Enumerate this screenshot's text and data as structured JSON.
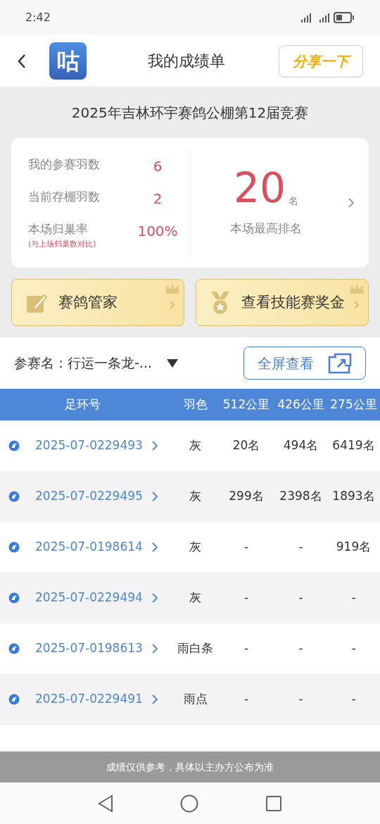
{
  "status_bar": {
    "time": "2:42"
  },
  "header": {
    "logo_text": "咕",
    "title": "我的成绩单",
    "share_button": "分享一下"
  },
  "race_title": "2025年吉林环宇赛鸽公棚第12届竞赛",
  "summary": {
    "stats": [
      {
        "label": "我的参赛羽数",
        "value": "6"
      },
      {
        "label": "当前存棚羽数",
        "value": "2"
      },
      {
        "label": "本场归巢率",
        "value": "100%",
        "note": "(与上场归巢数对比)"
      }
    ],
    "best_rank": "20",
    "rank_unit": "名",
    "rank_label": "本场最高排名"
  },
  "actions": [
    {
      "kind": "pencil",
      "label": "赛鸽管家"
    },
    {
      "kind": "medal",
      "label": "查看技能赛奖金"
    }
  ],
  "entrant": {
    "label": "参赛名：",
    "value": "行运一条龙-...",
    "fullscreen_button": "全屏查看"
  },
  "table": {
    "columns": [
      "足环号",
      "羽色",
      "512公里",
      "426公里",
      "275公里"
    ],
    "rows": [
      {
        "ring": "2025-07-0229493",
        "plumage": "灰",
        "r512": "20名",
        "r426": "494名",
        "r275": "6419名"
      },
      {
        "ring": "2025-07-0229495",
        "plumage": "灰",
        "r512": "299名",
        "r426": "2398名",
        "r275": "1893名"
      },
      {
        "ring": "2025-07-0198614",
        "plumage": "灰",
        "r512": "-",
        "r426": "-",
        "r275": "919名"
      },
      {
        "ring": "2025-07-0229494",
        "plumage": "灰",
        "r512": "-",
        "r426": "-",
        "r275": "-"
      },
      {
        "ring": "2025-07-0198613",
        "plumage": "雨白条",
        "r512": "-",
        "r426": "-",
        "r275": "-"
      },
      {
        "ring": "2025-07-0229491",
        "plumage": "雨点",
        "r512": "-",
        "r426": "-",
        "r275": "-"
      }
    ]
  },
  "footer_note": "成绩仅供参考，具体以主办方公布为准"
}
